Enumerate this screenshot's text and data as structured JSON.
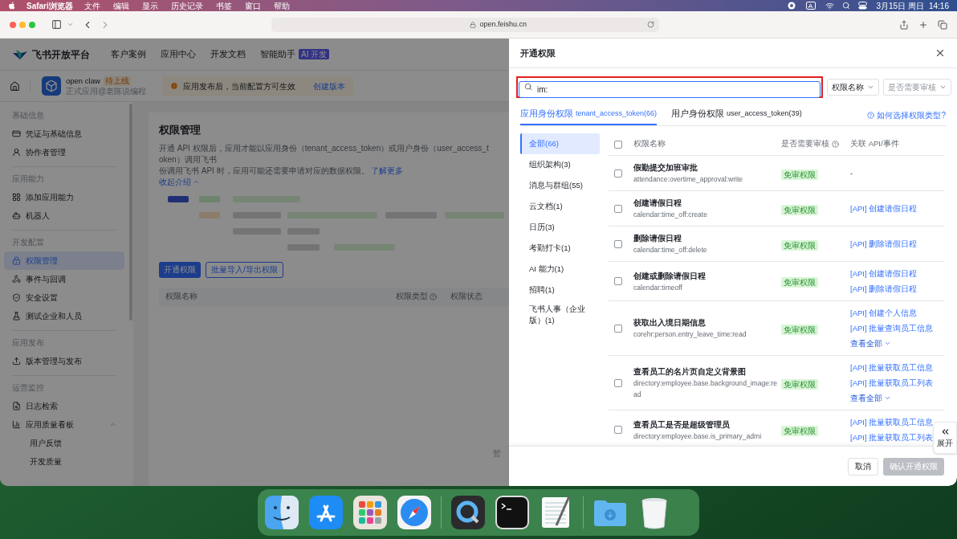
{
  "menubar": {
    "app": "Safari浏览器",
    "menus": [
      "文件",
      "编辑",
      "显示",
      "历史记录",
      "书签",
      "窗口",
      "帮助"
    ],
    "date": "3月15日 周日",
    "time": "14:16"
  },
  "browser": {
    "url": "open.feishu.cn"
  },
  "page": {
    "brand": "飞书开放平台",
    "nav": [
      {
        "label": "客户案例"
      },
      {
        "label": "应用中心"
      },
      {
        "label": "开发文档"
      },
      {
        "label": "智能助手",
        "badge": "AI 开发"
      }
    ],
    "app": {
      "name": "open claw",
      "status": "待上线",
      "subtitle": "正式应用@老陈说编程"
    },
    "notice": {
      "text": "应用发布后，当前配置方可生效",
      "action": "创建版本"
    },
    "sidebar": [
      {
        "section": "基础信息",
        "items": [
          {
            "label": "凭证与基础信息",
            "selected": false
          },
          {
            "label": "协作者管理",
            "selected": false
          }
        ]
      },
      {
        "section": "应用能力",
        "items": [
          {
            "label": "添加应用能力",
            "selected": false
          },
          {
            "label": "机器人",
            "selected": false
          }
        ]
      },
      {
        "section": "开发配置",
        "items": [
          {
            "label": "权限管理",
            "selected": true
          },
          {
            "label": "事件与回调",
            "selected": false
          },
          {
            "label": "安全设置",
            "selected": false
          },
          {
            "label": "测试企业和人员",
            "selected": false
          }
        ]
      },
      {
        "section": "应用发布",
        "items": [
          {
            "label": "版本管理与发布",
            "selected": false
          }
        ]
      },
      {
        "section": "运营监控",
        "items": [
          {
            "label": "日志检索",
            "selected": false
          },
          {
            "label": "应用质量看板",
            "selected": false,
            "expanded": true,
            "children": [
              {
                "label": "用户反馈",
                "selected": false
              },
              {
                "label": "开发质量",
                "selected": false
              }
            ]
          }
        ]
      }
    ],
    "content": {
      "title": "权限管理",
      "description_lines": [
        "开通 API 权限后，应用才能以应用身份（tenant_access_token）或用户身份（user_access_token）调用飞书",
        "份调用飞书 API 时，应用可能还需要申请对应的数据权限。"
      ],
      "link": "了解更多",
      "collapse": "收起介绍",
      "buttons": [
        {
          "label": "开通权限",
          "kind": "primary"
        },
        {
          "label": "批量导入/导出权限",
          "kind": "secondary"
        }
      ],
      "columns": [
        {
          "label": "权限名称"
        },
        {
          "label": "权限类型",
          "help": true
        },
        {
          "label": "权限状态"
        }
      ],
      "empty": "暂"
    }
  },
  "drawer": {
    "title": "开通权限",
    "search": {
      "value": "im:",
      "highlighted": true
    },
    "filters": [
      {
        "value": "权限名称"
      },
      {
        "placeholder": "是否需要审核"
      }
    ],
    "tabs": [
      {
        "label": "应用身份权限",
        "token": "tenant_access_token(66)",
        "selected": true
      },
      {
        "label": "用户身份权限",
        "token": "user_access_token(39)",
        "selected": false
      }
    ],
    "help_link": "如何选择权限类型?",
    "categories": [
      {
        "label": "全部(66)",
        "selected": true
      },
      {
        "label": "组织架构(3)",
        "selected": false
      },
      {
        "label": "消息与群组(55)",
        "selected": false
      },
      {
        "label": "云文档(1)",
        "selected": false
      },
      {
        "label": "日历(3)",
        "selected": false
      },
      {
        "label": "考勤打卡(1)",
        "selected": false
      },
      {
        "label": "AI 能力(1)",
        "selected": false
      },
      {
        "label": "招聘(1)",
        "selected": false
      },
      {
        "label": "飞书人事（企业版）(1)",
        "selected": false
      }
    ],
    "select_all": {
      "checked": false
    },
    "columns": [
      {
        "label": "权限名称"
      },
      {
        "label": "是否需要审核",
        "help": true
      },
      {
        "label": "关联 API/事件"
      }
    ],
    "rows": [
      {
        "name": "假勤提交加班审批",
        "scope": "attendance:overtime_approval:write",
        "review": "免审权限",
        "checked": false,
        "apis": [
          {
            "text": "-",
            "kind": "none"
          }
        ]
      },
      {
        "name": "创建请假日程",
        "scope": "calendar:time_off:create",
        "review": "免审权限",
        "checked": false,
        "apis": [
          {
            "text": "[API] 创建请假日程",
            "kind": "api"
          }
        ]
      },
      {
        "name": "删除请假日程",
        "scope": "calendar:time_off:delete",
        "review": "免审权限",
        "checked": false,
        "apis": [
          {
            "text": "[API] 删除请假日程",
            "kind": "api"
          }
        ]
      },
      {
        "name": "创建或删除请假日程",
        "scope": "calendar:timeoff",
        "review": "免审权限",
        "checked": false,
        "apis": [
          {
            "text": "[API] 创建请假日程",
            "kind": "api"
          },
          {
            "text": "[API] 删除请假日程",
            "kind": "api"
          }
        ]
      },
      {
        "name": "获取出入境日期信息",
        "scope": "corehr:person.entry_leave_time:read",
        "review": "免审权限",
        "checked": false,
        "apis": [
          {
            "text": "[API] 创建个人信息",
            "kind": "api"
          },
          {
            "text": "[API] 批量查询员工信息",
            "kind": "api"
          }
        ],
        "more": "查看全部"
      },
      {
        "name": "查看员工的名片页自定义背景图",
        "scope": "directory:employee.base.background_image:read",
        "review": "免审权限",
        "checked": false,
        "apis": [
          {
            "text": "[API] 批量获取员工信息",
            "kind": "api"
          },
          {
            "text": "[API] 批量获取员工列表",
            "kind": "api"
          }
        ],
        "more": "查看全部"
      },
      {
        "name": "查看员工是否是超级管理员",
        "scope": "directory:employee.base.is_primary_admi",
        "review": "免审权限",
        "checked": false,
        "apis": [
          {
            "text": "[API] 批量获取员工信息",
            "kind": "api"
          },
          {
            "text": "[API] 批量获取员工列表",
            "kind": "api"
          }
        ]
      }
    ],
    "buttons": [
      {
        "label": "取消",
        "disabled": false
      },
      {
        "label": "确认开通权限",
        "disabled": true
      }
    ],
    "expand_tab": {
      "label": "展开"
    }
  }
}
